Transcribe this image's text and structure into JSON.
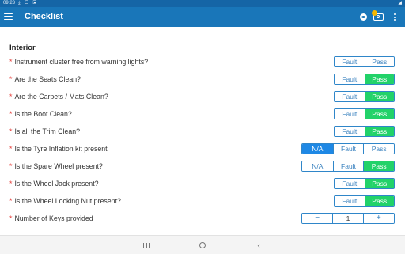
{
  "status_bar": {
    "time": "09:23",
    "icons": [
      "download-icon",
      "sim-icon",
      "notification-icon"
    ]
  },
  "app_bar": {
    "title": "Checklist",
    "actions": [
      "menu-icon",
      "eye-icon",
      "camera-icon",
      "more-vert-icon"
    ]
  },
  "section": {
    "title": "Interior"
  },
  "checklist": {
    "required_marker": "*",
    "items": [
      {
        "question": "Instrument cluster free from warning lights?",
        "options": [
          "Fault",
          "Pass"
        ],
        "selected": "Fault"
      },
      {
        "question": "Are the Seats Clean?",
        "options": [
          "Fault",
          "Pass"
        ],
        "selected": "Pass"
      },
      {
        "question": "Are the Carpets / Mats Clean?",
        "options": [
          "Fault",
          "Pass"
        ],
        "selected": "Pass"
      },
      {
        "question": "Is the Boot Clean?",
        "options": [
          "Fault",
          "Pass"
        ],
        "selected": "Pass"
      },
      {
        "question": "Is all the Trim Clean?",
        "options": [
          "Fault",
          "Pass"
        ],
        "selected": "Pass"
      },
      {
        "question": "Is the Tyre Inflation kit present",
        "options": [
          "N/A",
          "Fault",
          "Pass"
        ],
        "selected": "N/A"
      },
      {
        "question": "Is the Spare Wheel present?",
        "options": [
          "N/A",
          "Fault",
          "Pass"
        ],
        "selected": "Pass"
      },
      {
        "question": "Is the Wheel Jack present?",
        "options": [
          "Fault",
          "Pass"
        ],
        "selected": "Pass"
      },
      {
        "question": "Is the Wheel Locking Nut present?",
        "options": [
          "Fault",
          "Pass"
        ],
        "selected": "Pass"
      }
    ],
    "keys": {
      "question": "Number of Keys provided",
      "decrement_label": "−",
      "value": "1",
      "increment_label": "+"
    }
  },
  "nav_bar": {
    "back_glyph": "‹"
  },
  "colors": {
    "app_bar": "#1976b9",
    "status_bar": "#1565a6",
    "fault_selected": "#f05a12",
    "pass_selected": "#22d269",
    "na_selected": "#1e88e5",
    "segment_border": "#2f86c9",
    "required": "#e53935"
  }
}
